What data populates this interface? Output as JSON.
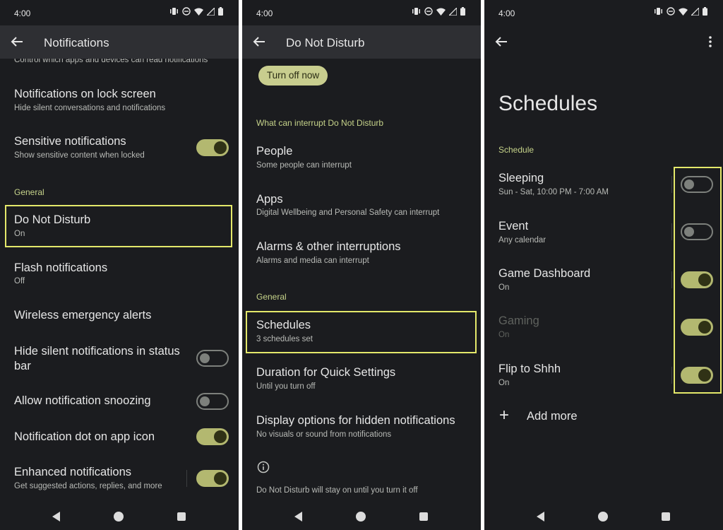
{
  "status_time": "4:00",
  "colors": {
    "background": "#1b1c1f",
    "app_bar": "#2e2f33",
    "accent": "#c6d38a",
    "toggle_on": "#b3b870",
    "highlight": "#e4e86a"
  },
  "panel1": {
    "title": "Notifications",
    "cut_text": "Control which apps and devices can read notifications",
    "items": [
      {
        "title": "Notifications on lock screen",
        "sub": "Hide silent conversations and notifications"
      },
      {
        "title": "Sensitive notifications",
        "sub": "Show sensitive content when locked",
        "toggle": "on"
      }
    ],
    "section": "General",
    "dnd": {
      "title": "Do Not Disturb",
      "sub": "On"
    },
    "flash": {
      "title": "Flash notifications",
      "sub": "Off"
    },
    "wireless": {
      "title": "Wireless emergency alerts"
    },
    "hide_silent": {
      "title_line1": "Hide silent notifications in status",
      "title_line2": "bar",
      "toggle": "off"
    },
    "snoozing": {
      "title": "Allow notification snoozing",
      "toggle": "off"
    },
    "dot": {
      "title": "Notification dot on app icon",
      "toggle": "on"
    },
    "enhanced": {
      "title": "Enhanced notifications",
      "sub": "Get suggested actions, replies, and more",
      "toggle": "on"
    }
  },
  "panel2": {
    "title": "Do Not Disturb",
    "turn_off_button": "Turn off now",
    "section1": "What can interrupt Do Not Disturb",
    "people": {
      "title": "People",
      "sub": "Some people can interrupt"
    },
    "apps": {
      "title": "Apps",
      "sub": "Digital Wellbeing and Personal Safety can interrupt"
    },
    "alarms": {
      "title": "Alarms & other interruptions",
      "sub": "Alarms and media can interrupt"
    },
    "section2": "General",
    "schedules": {
      "title": "Schedules",
      "sub": "3 schedules set"
    },
    "duration": {
      "title": "Duration for Quick Settings",
      "sub": "Until you turn off"
    },
    "display": {
      "title": "Display options for hidden notifications",
      "sub": "No visuals or sound from notifications"
    },
    "footer": "Do Not Disturb will stay on until you turn it off"
  },
  "panel3": {
    "title": "Schedules",
    "section": "Schedule",
    "schedules": [
      {
        "name": "Sleeping",
        "sub": "Sun - Sat, 10:00 PM - 7:00 AM",
        "state": "off"
      },
      {
        "name": "Event",
        "sub": "Any calendar",
        "state": "off"
      },
      {
        "name": "Game Dashboard",
        "sub": "On",
        "state": "on"
      },
      {
        "name": "Gaming",
        "sub": "On",
        "state": "on",
        "disabled": true
      },
      {
        "name": "Flip to Shhh",
        "sub": "On",
        "state": "on"
      }
    ],
    "add_more": "Add more"
  }
}
